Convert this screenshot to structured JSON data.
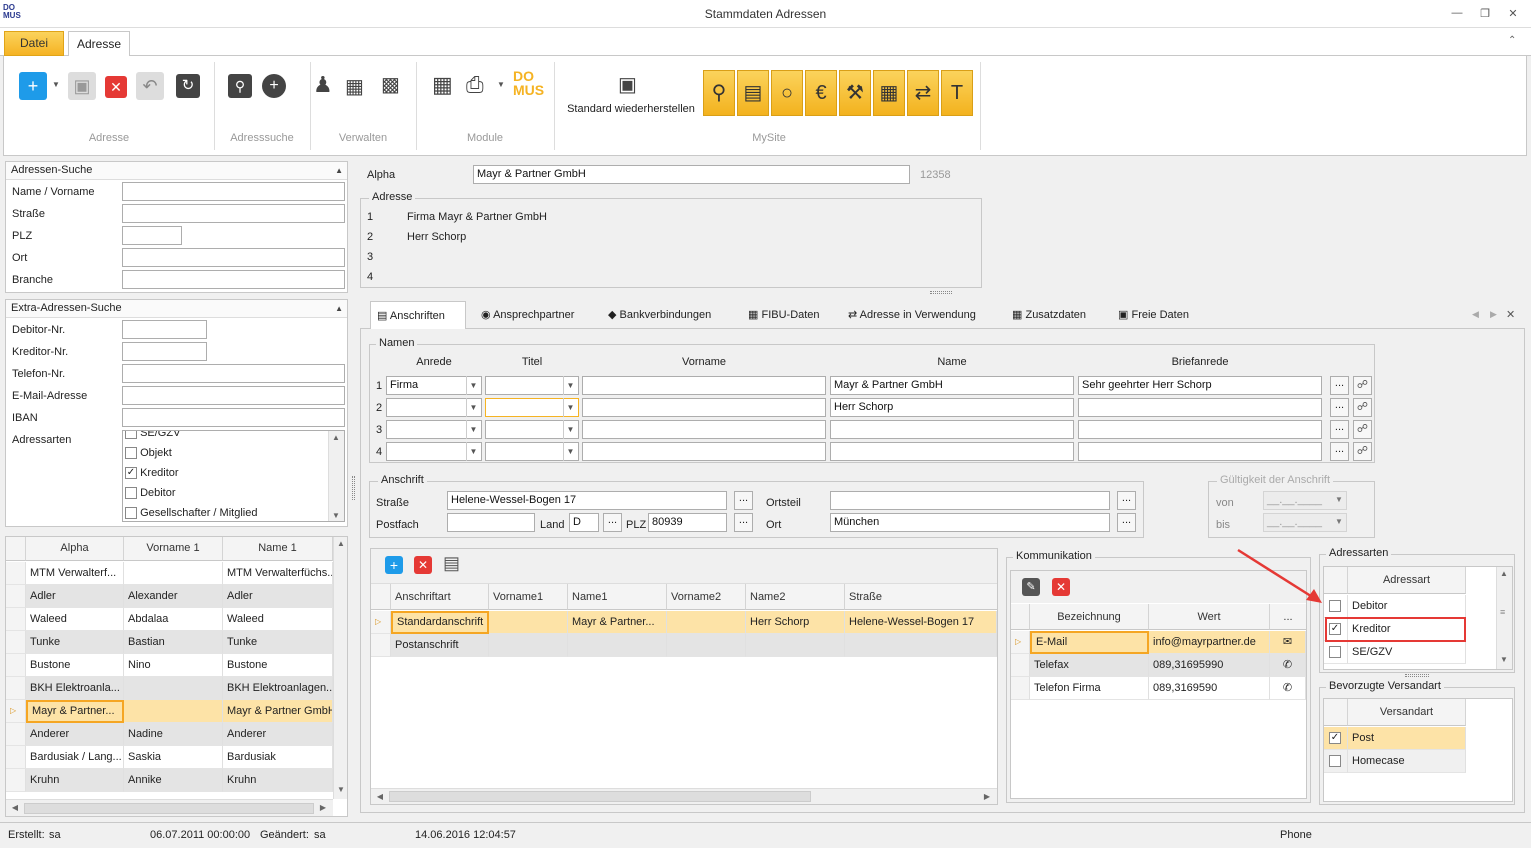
{
  "window": {
    "title": "Stammdaten Adressen",
    "logo": "DO MUS"
  },
  "ribbon_tabs": [
    "Datei",
    "Adresse"
  ],
  "ribbon": {
    "groups": [
      "Adresse",
      "Adresssuche",
      "Verwalten",
      "Module",
      "MySite"
    ],
    "restore_label": "Standard wiederherstellen"
  },
  "search": {
    "title": "Adressen-Suche",
    "labels": [
      "Name / Vorname",
      "Straße",
      "PLZ",
      "Ort",
      "Branche"
    ]
  },
  "extra_search": {
    "title": "Extra-Adressen-Suche",
    "labels": [
      "Debitor-Nr.",
      "Kreditor-Nr.",
      "Telefon-Nr.",
      "E-Mail-Adresse",
      "IBAN",
      "Adressarten"
    ],
    "adressarten": [
      {
        "label": "SE/GZV",
        "checked": false
      },
      {
        "label": "Objekt",
        "checked": false
      },
      {
        "label": "Kreditor",
        "checked": true
      },
      {
        "label": "Debitor",
        "checked": false
      },
      {
        "label": "Gesellschafter / Mitglied",
        "checked": false
      }
    ]
  },
  "result_grid": {
    "headers": [
      "Alpha",
      "Vorname 1",
      "Name 1"
    ],
    "rows": [
      [
        "MTM Verwalterf...",
        "",
        "MTM Verwalterfüchs..."
      ],
      [
        "Adler",
        "Alexander",
        "Adler"
      ],
      [
        "Waleed",
        "Abdalaa",
        "Waleed"
      ],
      [
        "Tunke",
        "Bastian",
        "Tunke"
      ],
      [
        "Bustone",
        "Nino",
        "Bustone"
      ],
      [
        "BKH Elektroanla...",
        "",
        "BKH Elektroanlagen..."
      ],
      [
        "Mayr & Partner...",
        "",
        "Mayr & Partner GmbH"
      ],
      [
        "Anderer",
        "Nadine",
        "Anderer"
      ],
      [
        "Bardusiak / Lang...",
        "Saskia",
        "Bardusiak"
      ],
      [
        "Kruhn",
        "Annike",
        "Kruhn"
      ]
    ],
    "selected_index": 6
  },
  "detail": {
    "alpha_label": "Alpha",
    "alpha_value": "Mayr & Partner GmbH",
    "id": "12358",
    "adresse_label": "Adresse",
    "adresse_lines": [
      {
        "n": "1",
        "text": "Firma Mayr & Partner GmbH"
      },
      {
        "n": "2",
        "text": "Herr Schorp"
      },
      {
        "n": "3",
        "text": ""
      },
      {
        "n": "4",
        "text": ""
      }
    ]
  },
  "tabs": [
    "Anschriften",
    "Ansprechpartner",
    "Bankverbindungen",
    "FIBU-Daten",
    "Adresse in Verwendung",
    "Zusatzdaten",
    "Freie Daten"
  ],
  "namen": {
    "legend": "Namen",
    "headers": [
      "Anrede",
      "Titel",
      "Vorname",
      "Name",
      "Briefanrede"
    ],
    "rows": [
      {
        "n": "1",
        "anrede": "Firma",
        "titel": "",
        "vorname": "",
        "name": "Mayr & Partner GmbH",
        "brief": "Sehr geehrter Herr Schorp"
      },
      {
        "n": "2",
        "anrede": "",
        "titel": "",
        "vorname": "",
        "name": "Herr Schorp",
        "brief": ""
      },
      {
        "n": "3",
        "anrede": "",
        "titel": "",
        "vorname": "",
        "name": "",
        "brief": ""
      },
      {
        "n": "4",
        "anrede": "",
        "titel": "",
        "vorname": "",
        "name": "",
        "brief": ""
      }
    ]
  },
  "anschrift": {
    "legend": "Anschrift",
    "strasse_label": "Straße",
    "strasse": "Helene-Wessel-Bogen 17",
    "postfach_label": "Postfach",
    "postfach": "",
    "land_label": "Land",
    "land": "D",
    "plz_label": "PLZ",
    "plz": "80939",
    "ortsteil_label": "Ortsteil",
    "ortsteil": "",
    "ort_label": "Ort",
    "ort": "München"
  },
  "gueltigkeit": {
    "legend": "Gültigkeit der Anschrift",
    "von_label": "von",
    "bis_label": "bis",
    "von_placeholder": "__.__.____",
    "bis_placeholder": "__.__.____"
  },
  "anschriften_grid": {
    "headers": [
      "Anschriftart",
      "Vorname1",
      "Name1",
      "Vorname2",
      "Name2",
      "Straße"
    ],
    "rows": [
      [
        "Standardanschrift",
        "",
        "Mayr & Partner...",
        "",
        "Herr Schorp",
        "Helene-Wessel-Bogen 17"
      ],
      [
        "Postanschrift",
        "",
        "",
        "",
        "",
        ""
      ]
    ]
  },
  "kommunikation": {
    "legend": "Kommunikation",
    "headers": [
      "Bezeichnung",
      "Wert",
      "..."
    ],
    "rows": [
      {
        "bez": "E-Mail",
        "wert": "info@mayrpartner.de"
      },
      {
        "bez": "Telefax",
        "wert": "089,31695990"
      },
      {
        "bez": "Telefon Firma",
        "wert": "089,3169590"
      }
    ]
  },
  "adressarten_panel": {
    "legend": "Adressarten",
    "header": "Adressart",
    "items": [
      {
        "label": "Debitor",
        "checked": false
      },
      {
        "label": "Kreditor",
        "checked": true
      },
      {
        "label": "SE/GZV",
        "checked": false
      }
    ]
  },
  "versandart": {
    "legend": "Bevorzugte Versandart",
    "header": "Versandart",
    "items": [
      {
        "label": "Post",
        "checked": true
      },
      {
        "label": "Homecase",
        "checked": false
      }
    ]
  },
  "status": {
    "erstellt_label": "Erstellt:",
    "erstellt_user": "sa",
    "erstellt_date": "06.07.2011 00:00:00",
    "geaendert_label": "Geändert:",
    "geaendert_user": "sa",
    "geaendert_date": "14.06.2016 12:04:57",
    "right": "Phone"
  },
  "colors": {
    "accent": "#f5b323",
    "selection": "#fde3a7",
    "annotation": "#e53935",
    "blue_button": "#1e9be9",
    "red_button": "#e53935"
  }
}
